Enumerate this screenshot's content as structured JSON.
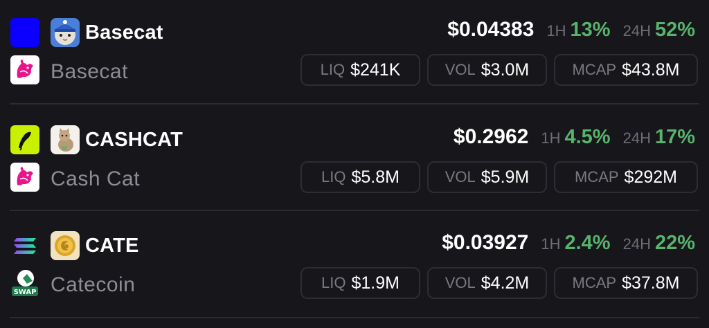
{
  "tokens": [
    {
      "symbol": "Basecat",
      "name": "Basecat",
      "chain_icon": "base-chain-icon",
      "dex_icon": "uniswap-icon",
      "price": "$0.04383",
      "change_1h_label": "1H",
      "change_1h": "13%",
      "change_24h_label": "24H",
      "change_24h": "52%",
      "liq_label": "LIQ",
      "liq": "$241K",
      "vol_label": "VOL",
      "vol": "$3.0M",
      "mcap_label": "MCAP",
      "mcap": "$43.8M"
    },
    {
      "symbol": "CASHCAT",
      "name": "Cash Cat",
      "chain_icon": "robinhood-chain-icon",
      "dex_icon": "uniswap-icon",
      "price": "$0.2962",
      "change_1h_label": "1H",
      "change_1h": "4.5%",
      "change_24h_label": "24H",
      "change_24h": "17%",
      "liq_label": "LIQ",
      "liq": "$5.8M",
      "vol_label": "VOL",
      "vol": "$5.9M",
      "mcap_label": "MCAP",
      "mcap": "$292M"
    },
    {
      "symbol": "CATE",
      "name": "Catecoin",
      "chain_icon": "solana-chain-icon",
      "dex_icon": "swap-pill-icon",
      "dex_icon_text": "SWAP",
      "price": "$0.03927",
      "change_1h_label": "1H",
      "change_1h": "2.4%",
      "change_24h_label": "24H",
      "change_24h": "22%",
      "liq_label": "LIQ",
      "liq": "$1.9M",
      "vol_label": "VOL",
      "vol": "$4.2M",
      "mcap_label": "MCAP",
      "mcap": "$37.8M"
    }
  ],
  "colors": {
    "background": "#17161b",
    "positive": "#58b46c",
    "base_blue": "#0b00ff",
    "uniswap_pink": "#e8148c",
    "divider": "#2c2b31"
  }
}
